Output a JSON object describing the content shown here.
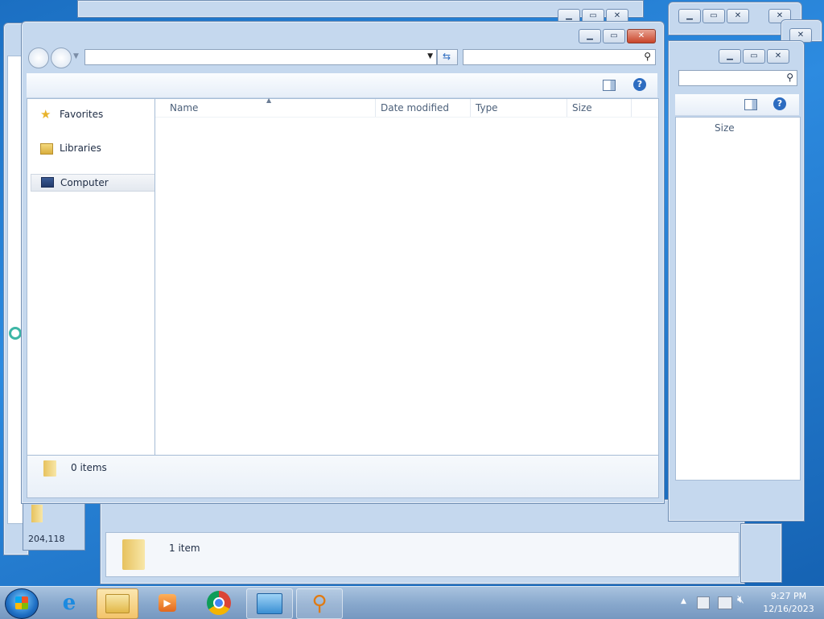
{
  "main_window": {
    "address_value": "",
    "search_placeholder": "",
    "nav": {
      "favorites": "Favorites",
      "libraries": "Libraries",
      "computer": "Computer"
    },
    "columns": [
      "Name",
      "Date modified",
      "Type",
      "Size"
    ],
    "status_text": "0 items"
  },
  "back_window": {
    "size_column": "Size"
  },
  "behind_window": {
    "status_text": "1 item",
    "partial_text": "204,118"
  },
  "taskbar": {
    "apps": [
      "start-orb",
      "internet-explorer",
      "windows-explorer",
      "media-player",
      "chrome",
      "control-panel",
      "search-tool"
    ],
    "clock_time": "9:27 PM",
    "clock_date": "12/16/2023"
  },
  "colors": {
    "desktop": "#1b6fc2",
    "window_frame": "#c5d8ee",
    "close_button": "#c9452a"
  }
}
